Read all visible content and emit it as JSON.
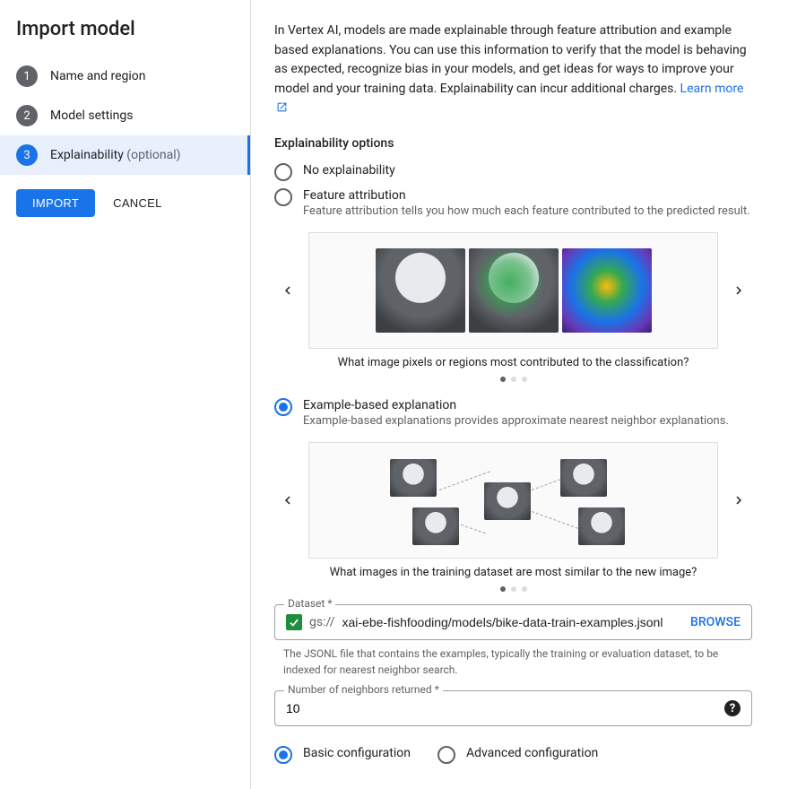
{
  "sidebar": {
    "title": "Import model",
    "steps": [
      {
        "num": "1",
        "label": "Name and region"
      },
      {
        "num": "2",
        "label": "Model settings"
      },
      {
        "num": "3",
        "label": "Explainability",
        "optional": "(optional)"
      }
    ],
    "import_btn": "IMPORT",
    "cancel_btn": "CANCEL"
  },
  "main": {
    "intro": "In Vertex AI, models are made explainable through feature attribution and example based explanations. You can use this information to verify that the model is behaving as expected, recognize bias in your models, and get ideas for ways to improve your model and your training data. Explainability can incur additional charges.",
    "learn_more": "Learn more",
    "options_title": "Explainability options",
    "opt_none": "No explainability",
    "opt_feature": "Feature attribution",
    "opt_feature_desc": "Feature attribution tells you how much each feature contributed to the predicted result.",
    "feature_caption": "What image pixels or regions most contributed to the classification?",
    "opt_example": "Example-based explanation",
    "opt_example_desc": "Example-based explanations provides approximate nearest neighbor explanations.",
    "example_caption": "What images in the training dataset are most similar to the new image?",
    "dataset_label": "Dataset *",
    "gs_prefix": "gs://",
    "dataset_value": "xai-ebe-fishfooding/models/bike-data-train-examples.jsonl",
    "browse": "BROWSE",
    "dataset_help": "The JSONL file that contains the examples, typically the training or evaluation dataset, to be indexed for nearest neighbor search.",
    "neighbors_label": "Number of neighbors returned *",
    "neighbors_value": "10",
    "config_basic": "Basic configuration",
    "config_advanced": "Advanced configuration"
  }
}
